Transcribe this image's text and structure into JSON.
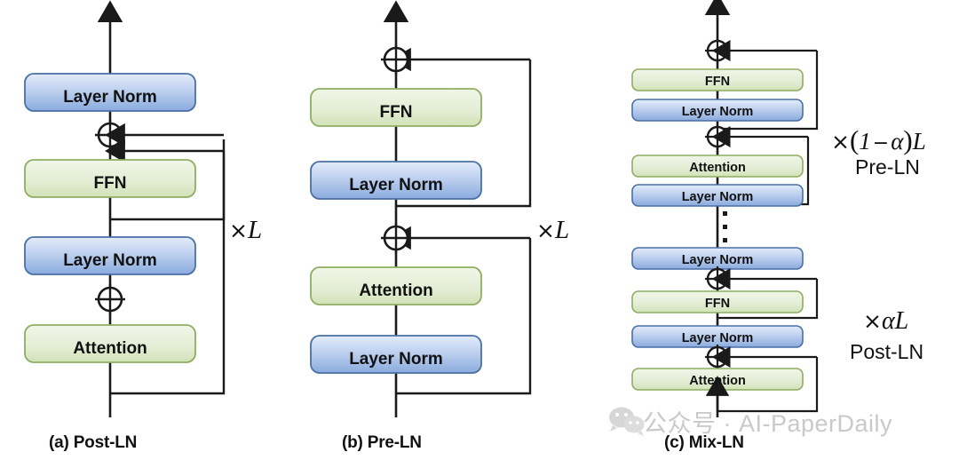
{
  "figure": {
    "title": "Transformer Layer Normalization Architectures",
    "colors": {
      "layer_norm_fill_top": "#dbe6f7",
      "layer_norm_fill_bottom": "#7b9fd4",
      "layer_norm_stroke": "#4a6fa5",
      "ffn_fill_top": "#eef3e4",
      "ffn_fill_bottom": "#cfe0b4",
      "ffn_stroke": "#8ead63",
      "line": "#1a1a1a",
      "text": "#111111",
      "watermark": "#c9c9c9"
    }
  },
  "panels": [
    {
      "id": "post-ln",
      "caption": "(a) Post-LN",
      "repeat_label": "×L",
      "repeat_label_math": "L",
      "repeat_times_symbol": "×",
      "sub_label": "",
      "blocks": [
        {
          "label": "Layer Norm",
          "type": "layer-norm"
        },
        {
          "label": "FFN",
          "type": "ffn"
        },
        {
          "label": "Layer Norm",
          "type": "layer-norm"
        },
        {
          "label": "Attention",
          "type": "ffn"
        }
      ],
      "order_description": "Attention -> add -> Layer Norm -> FFN -> add -> Layer Norm"
    },
    {
      "id": "pre-ln",
      "caption": "(b) Pre-LN",
      "repeat_label": "×L",
      "repeat_label_math": "L",
      "repeat_times_symbol": "×",
      "sub_label": "",
      "blocks": [
        {
          "label": "FFN",
          "type": "ffn"
        },
        {
          "label": "Layer Norm",
          "type": "layer-norm"
        },
        {
          "label": "Attention",
          "type": "ffn"
        },
        {
          "label": "Layer Norm",
          "type": "layer-norm"
        }
      ],
      "order_description": "Layer Norm -> Attention -> add -> Layer Norm -> FFN -> add"
    },
    {
      "id": "mix-ln",
      "caption": "(c) Mix-LN",
      "upper_group": {
        "repeat_times_symbol": "×",
        "repeat_expr_open": "(",
        "repeat_expr_one": "1",
        "repeat_expr_minus": "−",
        "repeat_expr_alpha": "α",
        "repeat_expr_close": ")",
        "repeat_expr_L": "L",
        "repeat_label_plain": "×(1 − α)L",
        "sub_label": "Pre-LN"
      },
      "lower_group": {
        "repeat_times_symbol": "×",
        "repeat_expr_alpha": "α",
        "repeat_expr_L": "L",
        "repeat_label_plain": "×αL",
        "sub_label": "Post-LN"
      },
      "blocks": [
        {
          "label": "FFN",
          "type": "ffn"
        },
        {
          "label": "Layer Norm",
          "type": "layer-norm"
        },
        {
          "label": "Attention",
          "type": "ffn"
        },
        {
          "label": "Layer Norm",
          "type": "layer-norm"
        },
        {
          "label": "Layer Norm",
          "type": "layer-norm"
        },
        {
          "label": "FFN",
          "type": "ffn"
        },
        {
          "label": "Layer Norm",
          "type": "layer-norm"
        },
        {
          "label": "Attention",
          "type": "ffn"
        }
      ],
      "ellipsis": "⋮"
    }
  ],
  "watermark": {
    "text": "公众号 · AI-PaperDaily",
    "icon": "wechat-icon"
  }
}
